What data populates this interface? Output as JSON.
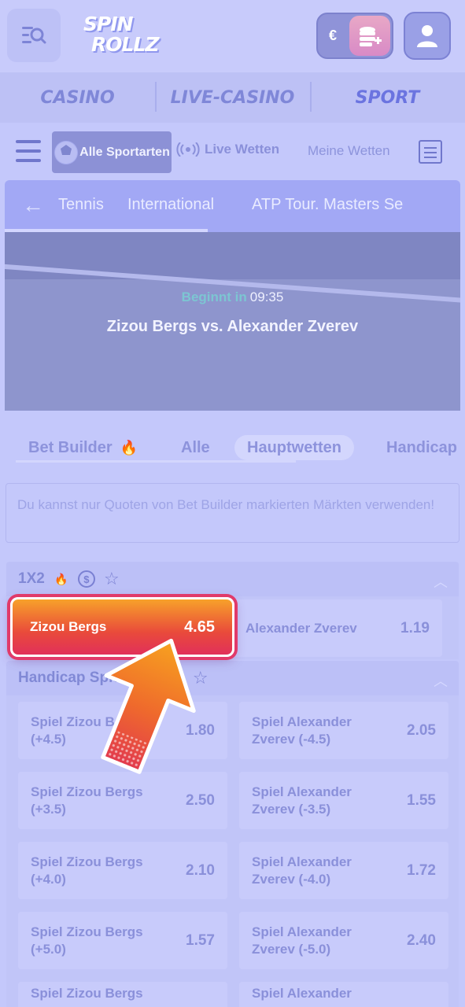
{
  "header": {
    "logo_line1": "SPIN",
    "logo_line2": "ROLLZ",
    "currency": "€"
  },
  "top_nav": [
    {
      "label": "CASINO"
    },
    {
      "label": "LIVE-CASINO"
    },
    {
      "label": "SPORT",
      "active": true
    }
  ],
  "sport_nav": {
    "all_sports": "Alle Sportarten",
    "live_bets": "Live Wetten",
    "my_bets": "Meine Wetten"
  },
  "breadcrumb": [
    "Tennis",
    "International",
    "ATP Tour. Masters Se"
  ],
  "event": {
    "starts_label": "Beginnt in",
    "starts_time": "09:35",
    "title": "Zizou Bergs vs. Alexander Zverev"
  },
  "market_tabs": [
    "Bet Builder",
    "Alle",
    "Hauptwetten",
    "Handicap"
  ],
  "notice": "Du kannst nur Quoten von Bet Builder markierten Märkten verwenden!",
  "markets": {
    "match": {
      "title": "1X2",
      "home": {
        "label": "Zizou Bergs",
        "odd": "4.65"
      },
      "away": {
        "label": "Alexander Zverev",
        "odd": "1.19"
      }
    },
    "handicap": {
      "title": "Handicap Spiele",
      "rows": [
        {
          "home": "Spiel Zizou Bergs (+4.5)",
          "home_odd": "1.80",
          "away": "Spiel Alexander Zverev (-4.5)",
          "away_odd": "2.05"
        },
        {
          "home": "Spiel Zizou Bergs (+3.5)",
          "home_odd": "2.50",
          "away": "Spiel Alexander Zverev (-3.5)",
          "away_odd": "1.55"
        },
        {
          "home": "Spiel Zizou Bergs (+4.0)",
          "home_odd": "2.10",
          "away": "Spiel Alexander Zverev (-4.0)",
          "away_odd": "1.72"
        },
        {
          "home": "Spiel Zizou Bergs (+5.0)",
          "home_odd": "1.57",
          "away": "Spiel Alexander Zverev (-5.0)",
          "away_odd": "2.40"
        },
        {
          "home": "Spiel Zizou Bergs",
          "home_odd": "",
          "away": "Spiel Alexander",
          "away_odd": ""
        }
      ]
    }
  },
  "colors": {
    "overlay": "#c4c8fb",
    "highlight_top": "#f7a12a",
    "highlight_bottom": "#e1305a",
    "arrow": "#f08a2a"
  },
  "icons": [
    "search-menu-icon",
    "coins-plus-icon",
    "user-icon",
    "hamburger-icon",
    "ball-icon",
    "live-signal-icon",
    "betslip-icon",
    "back-arrow-icon",
    "fire-icon",
    "coin-icon",
    "star-icon",
    "chevron-up-icon",
    "pointer-arrow-icon"
  ]
}
